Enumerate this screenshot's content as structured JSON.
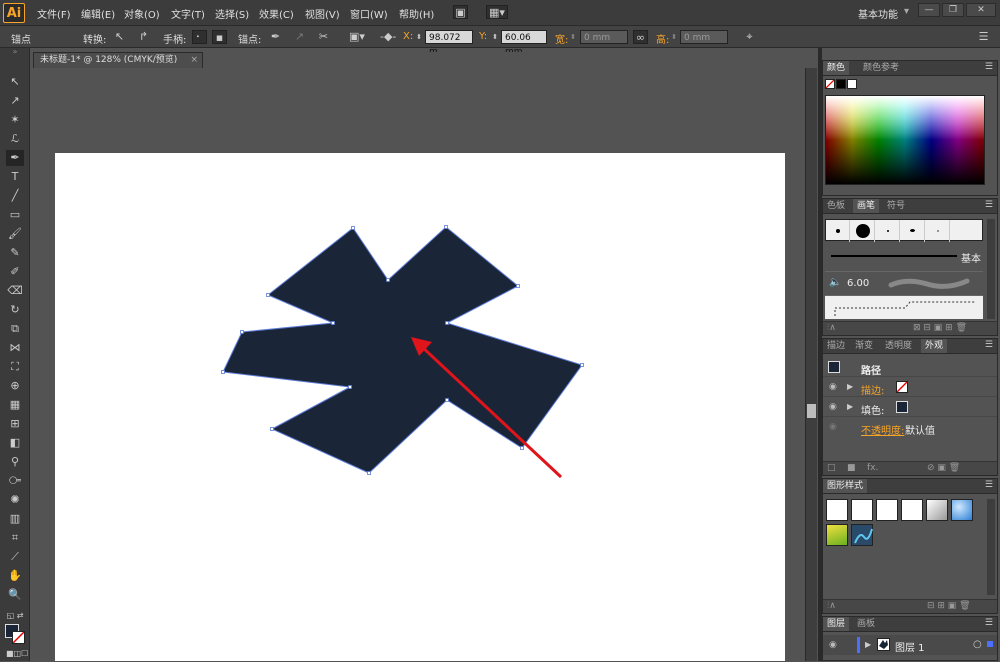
{
  "menubar": {
    "logo": "Ai",
    "items": [
      "文件(F)",
      "编辑(E)",
      "对象(O)",
      "文字(T)",
      "选择(S)",
      "效果(C)",
      "视图(V)",
      "窗口(W)",
      "帮助(H)"
    ],
    "workspace": "基本功能",
    "window_buttons": [
      "—",
      "❐",
      "✕"
    ]
  },
  "controlbar": {
    "anchor_label": "锚点",
    "convert_label": "转换:",
    "handles_label": "手柄:",
    "anchor_point_label": "锚点:",
    "x_label": "X:",
    "x_value": "98.072 m",
    "y_label": "Y:",
    "y_value": "60.06 mm",
    "w_label": "宽:",
    "w_value": "0 mm",
    "h_label": "高:",
    "h_value": "0 mm"
  },
  "document": {
    "tab_title": "未标题-1* @ 128% (CMYK/预览)",
    "tab_close": "×",
    "shape_fill": "#1b2538",
    "path_color": "#5b7bd6",
    "arrow_color": "#e0141b"
  },
  "color_panel": {
    "tabs": [
      "颜色",
      "颜色参考"
    ]
  },
  "brush_panel": {
    "tabs": [
      "色板",
      "画笔",
      "符号"
    ],
    "basic_label": "基本",
    "size_value": "6.00"
  },
  "appearance_panel": {
    "tabs": [
      "描边",
      "渐变",
      "透明度",
      "外观"
    ],
    "path_label": "路径",
    "stroke_label": "描边:",
    "fill_label": "填色:",
    "opacity_label": "不透明度:",
    "opacity_value": "默认值",
    "footer_fx": "fx."
  },
  "graphic_styles_panel": {
    "tabs": [
      "图形样式"
    ]
  },
  "layers_panel": {
    "tabs": [
      "图层",
      "画板"
    ],
    "layer_name": "图层 1"
  }
}
